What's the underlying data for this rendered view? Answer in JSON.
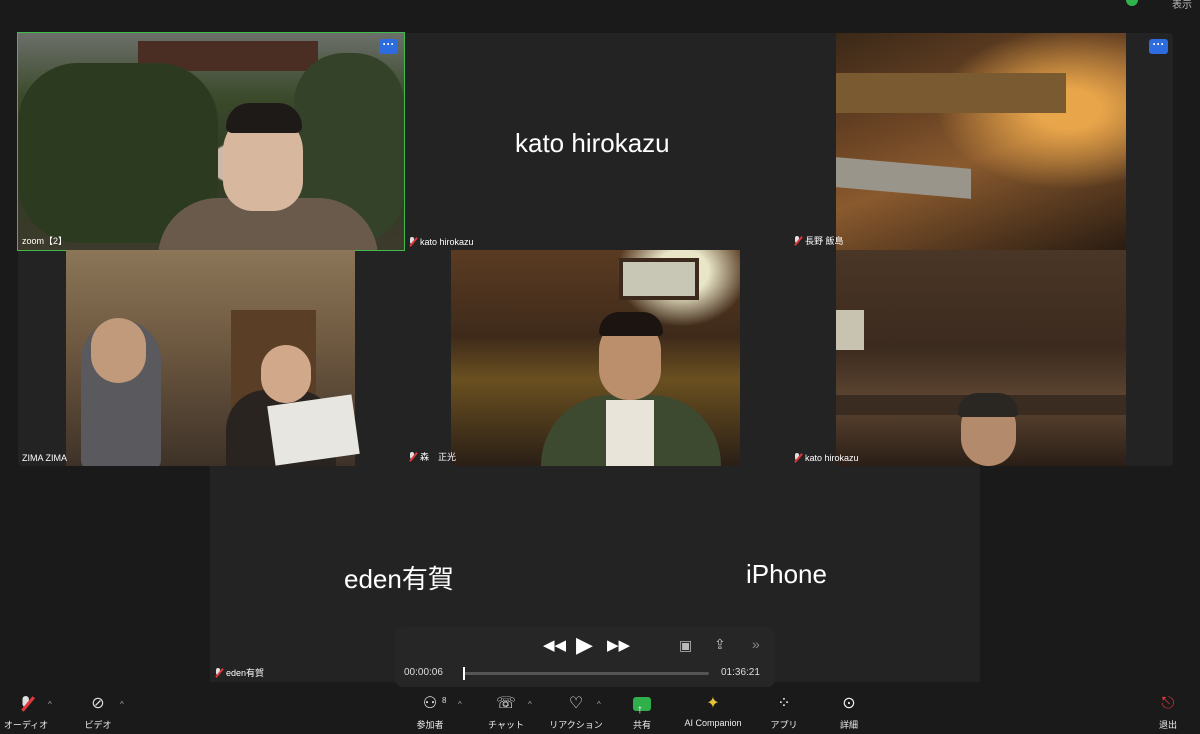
{
  "topbar": {
    "view_label": "表示"
  },
  "tiles": {
    "zoom2": {
      "name": "zoom【2】"
    },
    "kato_card": {
      "card_name": "kato hirokazu",
      "name": "kato hirokazu"
    },
    "nagano": {
      "name": "長野 飯島"
    },
    "zima": {
      "name": "ZIMA ZIMA"
    },
    "mori": {
      "name": "森　正光"
    },
    "kato2": {
      "name": "kato hirokazu"
    },
    "eden": {
      "card_name": "eden有賀",
      "name": "eden有賀"
    },
    "iphone": {
      "card_name": "iPhone"
    }
  },
  "more_label": "···",
  "player": {
    "current_time": "00:00:06",
    "total_time": "01:36:21",
    "progress_fraction": 0.001
  },
  "toolbar": {
    "audio": "オーディオ",
    "video": "ビデオ",
    "participants": "参加者",
    "participants_count": "8",
    "chat": "チャット",
    "reactions": "リアクション",
    "share": "共有",
    "ai_companion": "AI Companion",
    "apps": "アプリ",
    "more": "詳細",
    "leave": "退出"
  },
  "colors": {
    "selected_outline": "#3fbb4b",
    "more_button": "#2d6cdf",
    "muted_red": "#e0383b",
    "share_green": "#2fb04a"
  }
}
